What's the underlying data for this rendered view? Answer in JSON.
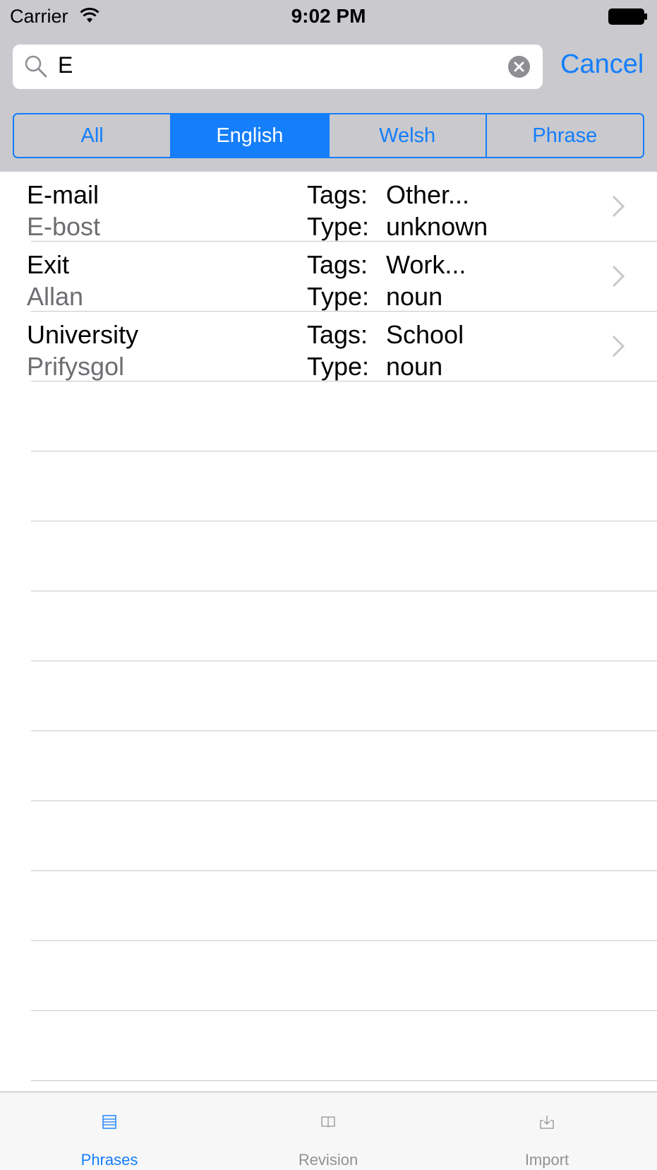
{
  "status_bar": {
    "carrier": "Carrier",
    "time": "9:02 PM"
  },
  "search": {
    "value": "E",
    "cancel_label": "Cancel"
  },
  "scope": {
    "segments": [
      {
        "label": "All",
        "selected": false
      },
      {
        "label": "English",
        "selected": true
      },
      {
        "label": "Welsh",
        "selected": false
      },
      {
        "label": "Phrase",
        "selected": false
      }
    ]
  },
  "results": [
    {
      "english": "E-mail",
      "welsh": "E-bost",
      "tags_label": "Tags:",
      "tags": "Other...",
      "type_label": "Type:",
      "type": "unknown"
    },
    {
      "english": "Exit",
      "welsh": "Allan",
      "tags_label": "Tags:",
      "tags": "Work...",
      "type_label": "Type:",
      "type": "noun"
    },
    {
      "english": "University",
      "welsh": "Prifysgol",
      "tags_label": "Tags:",
      "tags": "School",
      "type_label": "Type:",
      "type": "noun"
    }
  ],
  "tab_bar": {
    "tabs": [
      {
        "label": "Phrases",
        "icon": "list-icon",
        "active": true
      },
      {
        "label": "Revision",
        "icon": "book-icon",
        "active": false
      },
      {
        "label": "Import",
        "icon": "download-icon",
        "active": false
      }
    ]
  },
  "colors": {
    "accent": "#147efb",
    "header_background": "#c9c9ce",
    "secondary_text": "#6d6d72",
    "separator": "#c8c7cc"
  }
}
